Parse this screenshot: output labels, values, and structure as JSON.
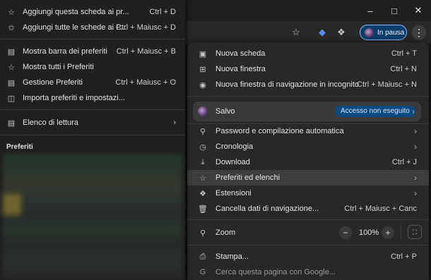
{
  "window": {
    "minimize_icon": "minimize-icon",
    "maximize_icon": "maximize-icon",
    "close_icon": "close-icon"
  },
  "toolbar": {
    "profile_chip_label": "In pausa"
  },
  "bookmarks_menu": {
    "items": [
      {
        "label": "Aggiungi questa scheda ai pr...",
        "shortcut": "Ctrl + D",
        "icon": "star-icon"
      },
      {
        "label": "Aggiungi tutte le schede ai P...",
        "shortcut": "Ctrl + Maiusc + D",
        "icon": "star-add-icon"
      },
      {
        "label": "Mostra barra dei preferiti",
        "shortcut": "Ctrl + Maiusc + B",
        "icon": "bookmarks-bar-icon"
      },
      {
        "label": "Mostra tutti i Preferiti",
        "shortcut": "",
        "icon": "star-icon"
      },
      {
        "label": "Gestione Preferiti",
        "shortcut": "Ctrl + Maiusc + O",
        "icon": "folder-icon"
      },
      {
        "label": "Importa preferiti e impostazi...",
        "shortcut": "",
        "icon": "import-icon"
      },
      {
        "label": "Elenco di lettura",
        "shortcut": "",
        "icon": "reading-list-icon"
      }
    ],
    "section_header": "Preferiti"
  },
  "main_menu": {
    "items": [
      {
        "label": "Nuova scheda",
        "shortcut": "Ctrl + T"
      },
      {
        "label": "Nuova finestra",
        "shortcut": "Ctrl + N"
      },
      {
        "label": "Nuova finestra di navigazione in incognito",
        "shortcut": "Ctrl + Maiusc + N"
      },
      {
        "label": "Password e compilazione automatica",
        "shortcut": ""
      },
      {
        "label": "Cronologia",
        "shortcut": ""
      },
      {
        "label": "Download",
        "shortcut": "Ctrl + J"
      },
      {
        "label": "Preferiti ed elenchi",
        "shortcut": ""
      },
      {
        "label": "Estensioni",
        "shortcut": ""
      },
      {
        "label": "Cancella dati di navigazione...",
        "shortcut": "Ctrl + Maiusc + Canc"
      },
      {
        "label": "Stampa...",
        "shortcut": "Ctrl + P"
      },
      {
        "label": "Cerca questa pagina con Google...",
        "shortcut": ""
      }
    ],
    "profile": {
      "name": "Salvo",
      "status": "Accesso non eseguito"
    },
    "zoom": {
      "label": "Zoom",
      "value": "100%",
      "minus": "−",
      "plus": "+"
    }
  },
  "colors": {
    "accent": "#8ab4f8",
    "menu_bg": "#282828",
    "highlight": "#3c3c3c"
  }
}
